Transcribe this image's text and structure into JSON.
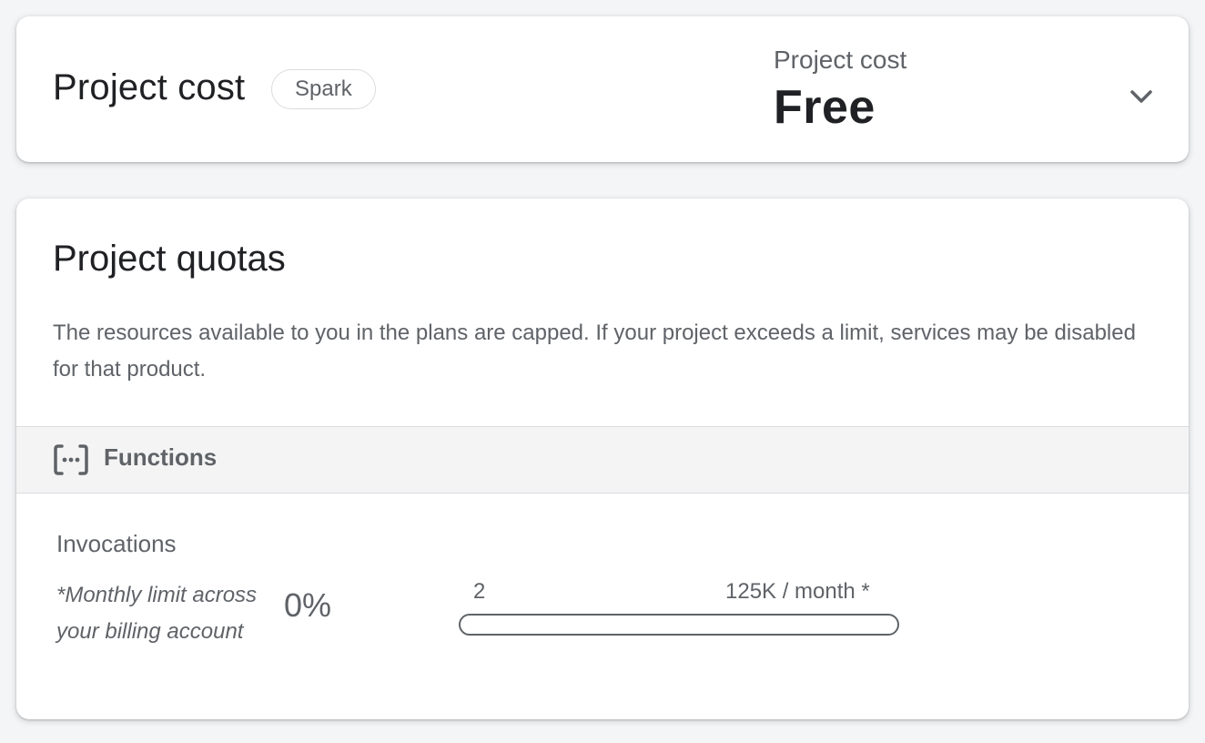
{
  "cost_card": {
    "title": "Project cost",
    "plan_badge": "Spark",
    "summary_label": "Project cost",
    "summary_value": "Free",
    "expand_icon": "chevron-down-icon"
  },
  "quota_card": {
    "title": "Project quotas",
    "description": "The resources available to you in the plans are capped. If your project exceeds a limit, services may be disabled for that product.",
    "section": {
      "icon": "functions-icon",
      "label": "Functions"
    },
    "metric": {
      "name": "Invocations",
      "note": "*Monthly limit across your billing account",
      "percent_text": "0%",
      "usage_value": "2",
      "limit_text": "125K / month *",
      "usage_fraction": 1.6e-05
    }
  },
  "colors": {
    "page_background": "#f4f5f7",
    "card_background": "#ffffff",
    "text_primary": "#202124",
    "text_secondary": "#5f6368",
    "divider": "#dadce0",
    "section_header_background": "#f4f4f4"
  }
}
